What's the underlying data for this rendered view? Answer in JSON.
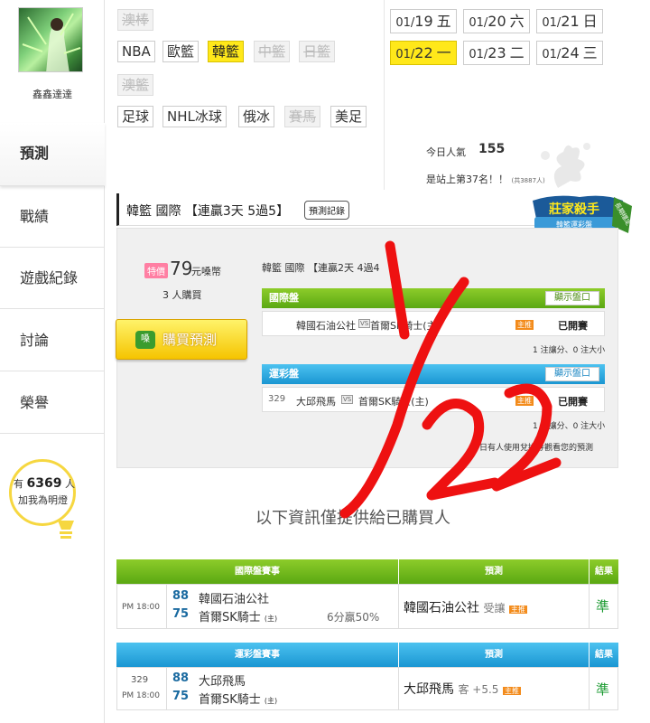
{
  "user": {
    "name": "鑫鑫達達"
  },
  "sidebar": {
    "items": [
      {
        "label": "預測",
        "active": true
      },
      {
        "label": "戰績"
      },
      {
        "label": "遊戲紀錄"
      },
      {
        "label": "討論"
      },
      {
        "label": "榮譽"
      }
    ],
    "bulb": {
      "prefix": "有",
      "count": "6369",
      "suffix": "人",
      "line2": "加我為明燈"
    }
  },
  "leagues": {
    "row1": [
      {
        "label": "澳棒",
        "disabled": true
      }
    ],
    "row2": [
      {
        "label": "NBA"
      },
      {
        "label": "歐籃"
      },
      {
        "label": "韓籃",
        "active": true
      },
      {
        "label": "中籃",
        "disabled": true
      },
      {
        "label": "日籃",
        "disabled": true
      }
    ],
    "row3": [
      {
        "label": "澳籃",
        "disabled": true
      }
    ],
    "row4": [
      {
        "label": "足球"
      },
      {
        "label": "NHL冰球"
      },
      {
        "label": "俄冰"
      },
      {
        "label": "賽馬",
        "disabled": true
      },
      {
        "label": "美足"
      }
    ]
  },
  "dates": [
    {
      "md": "01/",
      "day": "19",
      "wd": "五"
    },
    {
      "md": "01/",
      "day": "20",
      "wd": "六"
    },
    {
      "md": "01/",
      "day": "21",
      "wd": "日"
    },
    {
      "md": "01/",
      "day": "22",
      "wd": "一",
      "active": true
    },
    {
      "md": "01/",
      "day": "23",
      "wd": "二"
    },
    {
      "md": "01/",
      "day": "24",
      "wd": "三"
    }
  ],
  "popularity": {
    "label": "今日人氣",
    "value": "155",
    "rank": "是站上第37名！！",
    "rank_small": "(共3887人)"
  },
  "prediction": {
    "title": "韓籃 國際 【連贏3天 5過5】",
    "record_button": "預測記錄",
    "badge_title": "莊家殺手",
    "badge_sub": "韓籃運彩盤",
    "badge_ribbon": "長期穩定",
    "price_tag": "特價",
    "price": "79",
    "price_unit": "元嗓幣",
    "buyers": "3 人購買",
    "buy_button": "購買預測",
    "buy_icon": "嗓",
    "streak2": "韓籃 國際 【連贏2天 4過4",
    "intl_section": "國際盤",
    "lottery_section": "運彩盤",
    "show_odds": "顯示盤口",
    "intl_match": {
      "home": "韓國石油公社",
      "vs": "VS",
      "away": "首爾SK騎士(主)",
      "host": "主推",
      "status": "已開賽"
    },
    "intl_note": "1 注讓分、0 注大小",
    "lottery_match": {
      "no": "329",
      "home": "大邱飛馬",
      "vs": "VS",
      "away": "首爾SK騎士(主)",
      "host": "主推",
      "status": "已開賽"
    },
    "lottery_note": "1 注讓分、0 注大小",
    "coupon_note": "今日有人使用兌換券觀看您的預測"
  },
  "info_note": "以下資訊僅提供給已購買人",
  "intl_table": {
    "headers": [
      "國際盤賽事",
      "預測",
      "結果"
    ],
    "row": {
      "time": "PM 18:00",
      "score1": "88",
      "team1": "韓國石油公社",
      "score2": "75",
      "team2": "首爾SK騎士",
      "team2_mark": "(主)",
      "handicap": "6分贏50%",
      "pick": "韓國石油公社",
      "pick_type": "受讓",
      "host": "主推",
      "result": "準"
    }
  },
  "lottery_table": {
    "headers": [
      "運彩盤賽事",
      "預測",
      "結果"
    ],
    "row": {
      "no": "329",
      "time": "PM 18:00",
      "score1": "88",
      "team1": "大邱飛馬",
      "score2": "75",
      "team2": "首爾SK騎士",
      "team2_mark": "(主)",
      "pick": "大邱飛馬",
      "pick_type": "客 +5.5",
      "host": "主推",
      "result": "準"
    }
  },
  "annotation": {
    "text": "1/22"
  },
  "colors": {
    "green": "#6cb31c",
    "blue": "#22a4dd",
    "yellow": "#ffe81a",
    "red_mark": "#ee1111"
  }
}
